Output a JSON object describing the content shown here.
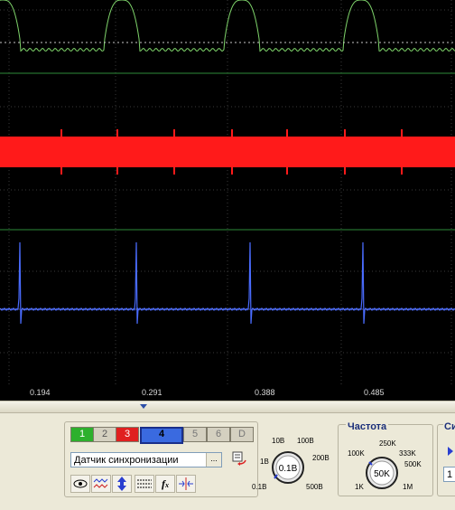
{
  "scope": {
    "colors": {
      "background": "#000000",
      "grid": "#3a3a3a",
      "divider": "#2e8b3a",
      "ch1": "#7ed36a",
      "ch2": "#ff1a1a",
      "ch3": "#4a6cff"
    },
    "ticks": [
      "0.194",
      "0.291",
      "0.388",
      "0.485"
    ]
  },
  "channels": {
    "buttons": [
      {
        "label": "1",
        "color": "#2db02d"
      },
      {
        "label": "2",
        "color": "#d4d0c0"
      },
      {
        "label": "3",
        "color": "#e02020"
      },
      {
        "label": "4",
        "color": "#3a6ae0"
      },
      {
        "label": "5",
        "color": "#d4d0c0"
      },
      {
        "label": "6",
        "color": "#d4d0c0"
      },
      {
        "label": "D",
        "color": "#d4d0c0"
      }
    ],
    "sensor": "Датчик синхронизации",
    "browse": "...",
    "tools": [
      "eye-icon",
      "wave-icon",
      "updown-icon",
      "lines-icon",
      "function-icon",
      "sync-icon"
    ]
  },
  "amplitude": {
    "value": "0.1В",
    "labels": {
      "l1": "10В",
      "l2": "100В",
      "l3": "1В",
      "l4": "200В",
      "l5": "0.1В",
      "l6": "500В"
    }
  },
  "frequency": {
    "title": "Частота",
    "value": "50K",
    "labels": {
      "l1": "250K",
      "l2": "100K",
      "l3": "333K",
      "l4": "500K",
      "l5": "1K",
      "l6": "1M"
    }
  },
  "right_group": {
    "title": "Си",
    "value": "1"
  }
}
